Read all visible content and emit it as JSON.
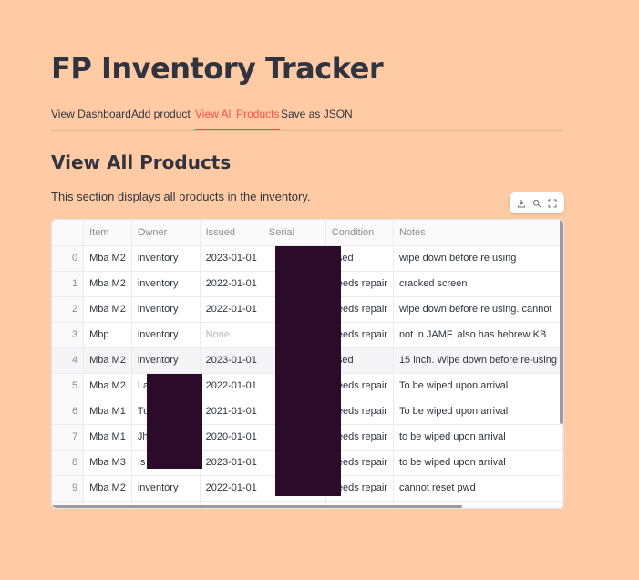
{
  "app": {
    "title": "FP Inventory Tracker"
  },
  "tabs": [
    {
      "label": "View Dashboard"
    },
    {
      "label": "Add product"
    },
    {
      "label": "View All Products"
    },
    {
      "label": "Save as JSON"
    }
  ],
  "section": {
    "title": "View All Products",
    "description": "This section displays all products in the inventory."
  },
  "toolbar": {
    "icons": [
      "download-icon",
      "search-icon",
      "fullscreen-icon"
    ]
  },
  "table": {
    "columns": [
      "",
      "Item",
      "Owner",
      "Issued",
      "Serial",
      "Condition",
      "Notes"
    ],
    "rows": [
      [
        "0",
        "Mba M2",
        "inventory",
        "2023-01-01",
        "",
        "used",
        "wipe down before re using"
      ],
      [
        "1",
        "Mba M2",
        "inventory",
        "2022-01-01",
        "",
        "needs repair",
        "cracked screen"
      ],
      [
        "2",
        "Mba M2",
        "inventory",
        "2022-01-01",
        "",
        "needs repair",
        "wipe down before re using. cannot"
      ],
      [
        "3",
        "Mbp",
        "inventory",
        "None",
        "",
        "needs repair",
        "not in JAMF. also has hebrew KB"
      ],
      [
        "4",
        "Mba M2",
        "inventory",
        "2023-01-01",
        "",
        "used",
        "15 inch. Wipe down before re-using"
      ],
      [
        "5",
        "Mba M2",
        "La",
        "2022-01-01",
        "",
        "needs repair",
        "To be wiped upon arrival"
      ],
      [
        "6",
        "Mba M1",
        "Tu",
        "2021-01-01",
        "",
        "needs repair",
        "To be wiped upon arrival"
      ],
      [
        "7",
        "Mba M1",
        "Jh",
        "2020-01-01",
        "",
        "needs repair",
        "to be wiped upon arrival"
      ],
      [
        "8",
        "Mba M3",
        "Is",
        "2023-01-01",
        "",
        "needs repair",
        "to be wiped upon arrival"
      ],
      [
        "9",
        "Mba M2",
        "inventory",
        "2022-01-01",
        "",
        "needs repair",
        "cannot reset pwd"
      ],
      [
        "10",
        "",
        "",
        "",
        "",
        "",
        ""
      ]
    ]
  },
  "colors": {
    "accent": "#ff4b4b",
    "background": "#ffcba4",
    "redaction": "#2b0a2a"
  }
}
